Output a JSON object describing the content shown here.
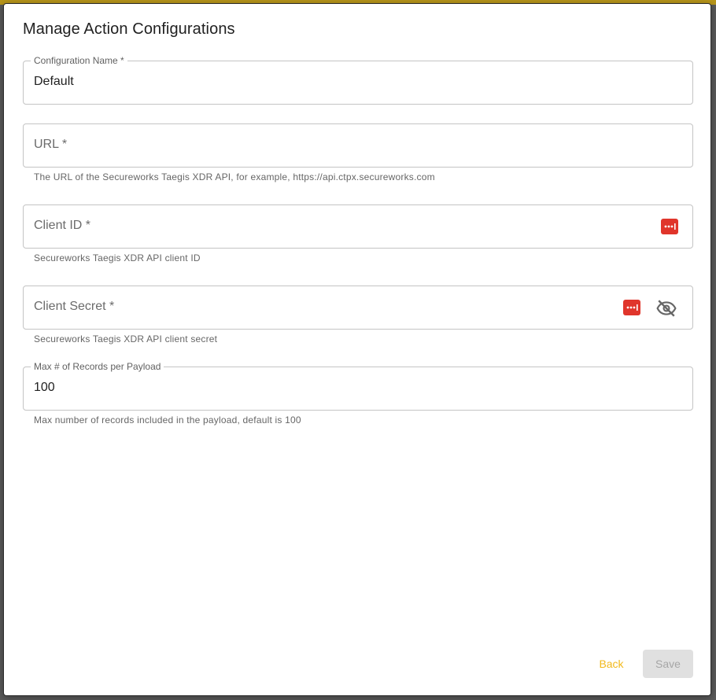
{
  "dialog": {
    "title": "Manage Action Configurations"
  },
  "fields": {
    "config_name": {
      "label": "Configuration Name *",
      "value": "Default"
    },
    "url": {
      "placeholder": "URL *",
      "helper": "The URL of the Secureworks Taegis XDR API, for example, https://api.ctpx.secureworks.com"
    },
    "client_id": {
      "placeholder": "Client ID *",
      "helper": "Secureworks Taegis XDR API client ID",
      "icon": "password-manager-icon"
    },
    "client_secret": {
      "placeholder": "Client Secret *",
      "helper": "Secureworks Taegis XDR API client secret",
      "icons": [
        "password-manager-icon",
        "eye-off-icon"
      ]
    },
    "max_records": {
      "label": "Max # of Records per Payload",
      "value": "100",
      "helper": "Max number of records included in the payload, default is 100"
    }
  },
  "actions": {
    "back_label": "Back",
    "save_label": "Save"
  },
  "colors": {
    "accent": "#f2b91c",
    "key_icon": "#e0352b",
    "border": "#c4c4c4"
  }
}
